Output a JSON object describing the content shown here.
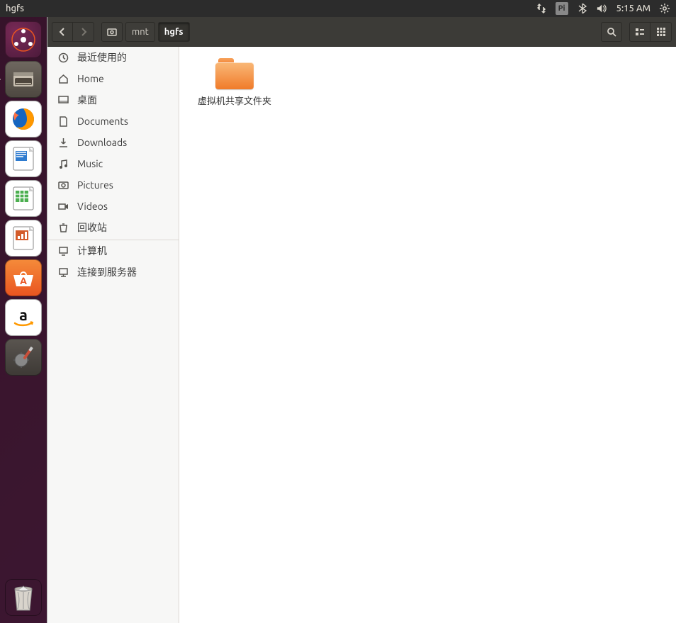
{
  "menubar": {
    "title": "hgfs",
    "indicators": {
      "network": "network-icon",
      "input": "Pi",
      "bluetooth": "bluetooth-icon",
      "sound": "sound-icon",
      "time": "5:15 AM",
      "session": "gear-icon"
    }
  },
  "launcher": {
    "apps": [
      {
        "id": "dash",
        "name": "Dash"
      },
      {
        "id": "files",
        "name": "Files",
        "selected": true
      },
      {
        "id": "firefox",
        "name": "Firefox"
      },
      {
        "id": "writer",
        "name": "LibreOffice Writer"
      },
      {
        "id": "calc",
        "name": "LibreOffice Calc"
      },
      {
        "id": "impress",
        "name": "LibreOffice Impress"
      },
      {
        "id": "software",
        "name": "Ubuntu Software"
      },
      {
        "id": "amazon",
        "name": "Amazon"
      },
      {
        "id": "settings",
        "name": "System Settings"
      }
    ],
    "trash": {
      "id": "trash",
      "name": "Trash"
    }
  },
  "toolbar": {
    "path": [
      {
        "label": "mnt",
        "active": false
      },
      {
        "label": "hgfs",
        "active": true
      }
    ]
  },
  "sidebar": {
    "places": [
      {
        "icon": "clock-icon",
        "label": "最近使用的"
      },
      {
        "icon": "home-icon",
        "label": "Home"
      },
      {
        "icon": "desktop-icon",
        "label": "桌面"
      },
      {
        "icon": "documents-icon",
        "label": "Documents"
      },
      {
        "icon": "downloads-icon",
        "label": "Downloads"
      },
      {
        "icon": "music-icon",
        "label": "Music"
      },
      {
        "icon": "pictures-icon",
        "label": "Pictures"
      },
      {
        "icon": "videos-icon",
        "label": "Videos"
      },
      {
        "icon": "trash-icon",
        "label": "回收站"
      }
    ],
    "devices": [
      {
        "icon": "computer-icon",
        "label": "计算机"
      },
      {
        "icon": "server-icon",
        "label": "连接到服务器"
      }
    ]
  },
  "content": {
    "items": [
      {
        "type": "folder",
        "name": "虚拟机共享文件夹"
      }
    ]
  }
}
